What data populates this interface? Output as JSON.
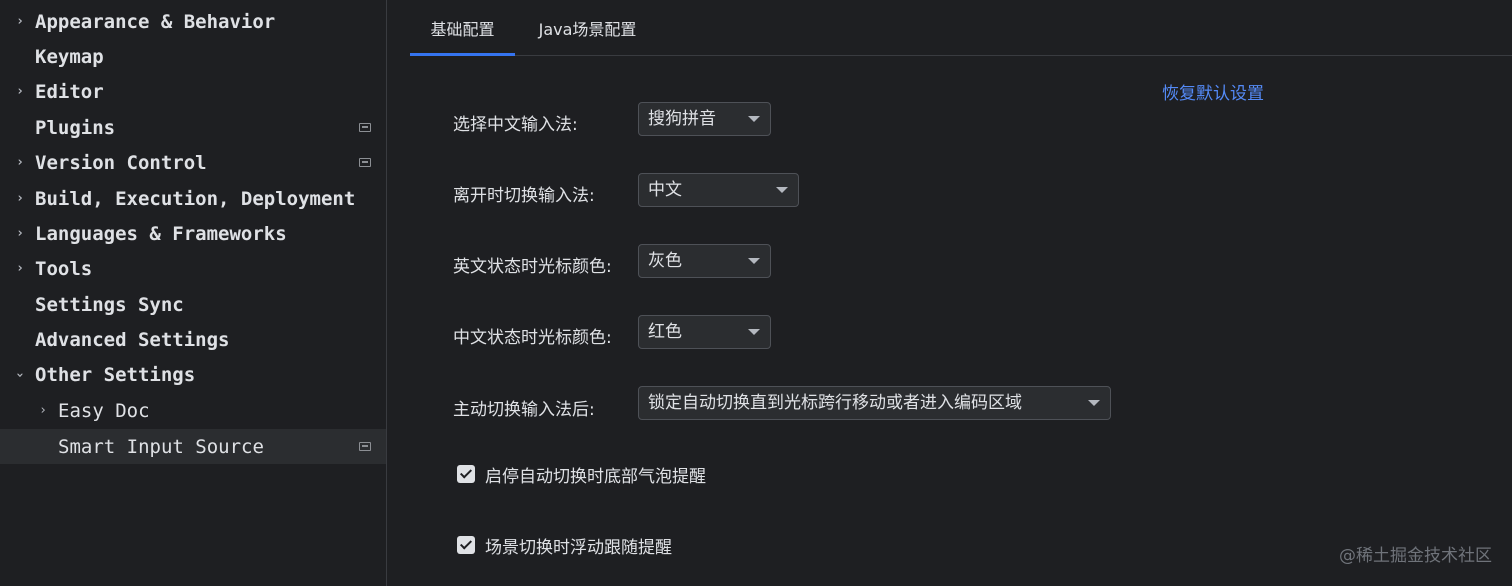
{
  "sidebar": {
    "items": [
      {
        "label": "Appearance & Behavior",
        "chevron": "right"
      },
      {
        "label": "Keymap",
        "chevron": ""
      },
      {
        "label": "Editor",
        "chevron": "right"
      },
      {
        "label": "Plugins",
        "chevron": "",
        "pinned": true
      },
      {
        "label": "Version Control",
        "chevron": "right",
        "pinned": true
      },
      {
        "label": "Build, Execution, Deployment",
        "chevron": "right"
      },
      {
        "label": "Languages & Frameworks",
        "chevron": "right"
      },
      {
        "label": "Tools",
        "chevron": "right"
      },
      {
        "label": "Settings Sync",
        "chevron": ""
      },
      {
        "label": "Advanced Settings",
        "chevron": ""
      },
      {
        "label": "Other Settings",
        "chevron": "down"
      },
      {
        "label": "Easy Doc",
        "chevron": "right"
      },
      {
        "label": "Smart Input Source",
        "chevron": "",
        "pinned": true,
        "selected": true
      }
    ]
  },
  "tabs": [
    {
      "label": "基础配置",
      "active": true
    },
    {
      "label": "Java场景配置",
      "active": false
    }
  ],
  "restore_defaults": "恢复默认设置",
  "form": {
    "input_method_label": "选择中文输入法:",
    "input_method_value": "搜狗拼音",
    "leave_label": "离开时切换输入法:",
    "leave_value": "中文",
    "en_cursor_label": "英文状态时光标颜色:",
    "en_cursor_value": "灰色",
    "zh_cursor_label": "中文状态时光标颜色:",
    "zh_cursor_value": "红色",
    "manual_switch_label": "主动切换输入法后:",
    "manual_switch_value": "锁定自动切换直到光标跨行移动或者进入编码区域"
  },
  "checkboxes": [
    {
      "label": "启停自动切换时底部气泡提醒",
      "checked": true
    },
    {
      "label": "场景切换时浮动跟随提醒",
      "checked": true
    }
  ],
  "watermark": "@稀土掘金技术社区",
  "colors": {
    "background": "#1e1f22",
    "accent": "#3574f0",
    "link": "#548af7"
  }
}
